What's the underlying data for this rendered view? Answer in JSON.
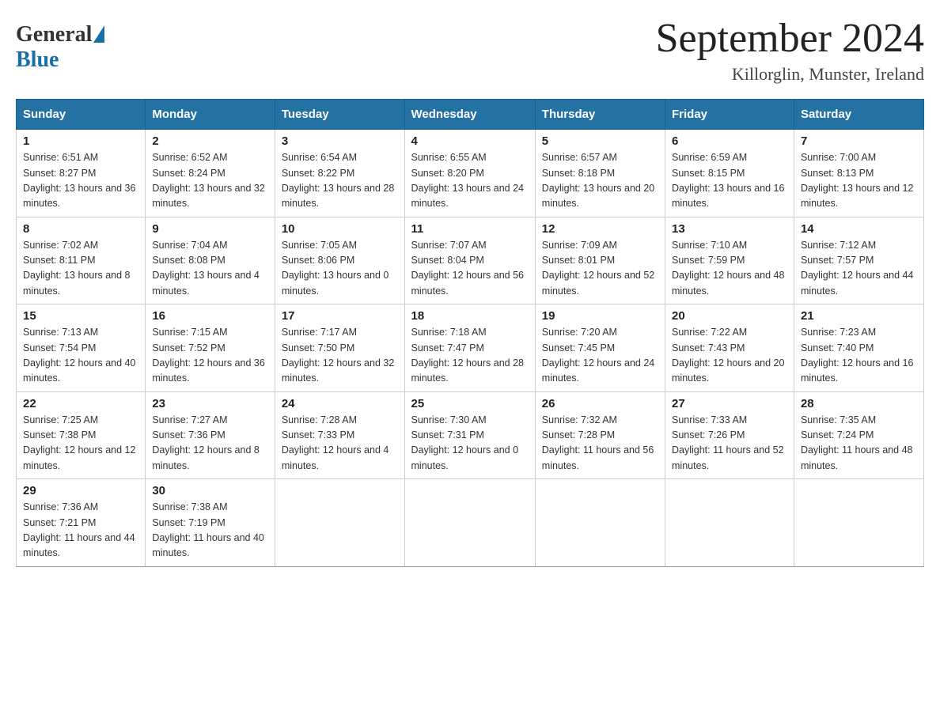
{
  "header": {
    "logo_general": "General",
    "logo_blue": "Blue",
    "month_title": "September 2024",
    "location": "Killorglin, Munster, Ireland"
  },
  "columns": [
    "Sunday",
    "Monday",
    "Tuesday",
    "Wednesday",
    "Thursday",
    "Friday",
    "Saturday"
  ],
  "weeks": [
    [
      {
        "day": "1",
        "sunrise": "6:51 AM",
        "sunset": "8:27 PM",
        "daylight": "13 hours and 36 minutes."
      },
      {
        "day": "2",
        "sunrise": "6:52 AM",
        "sunset": "8:24 PM",
        "daylight": "13 hours and 32 minutes."
      },
      {
        "day": "3",
        "sunrise": "6:54 AM",
        "sunset": "8:22 PM",
        "daylight": "13 hours and 28 minutes."
      },
      {
        "day": "4",
        "sunrise": "6:55 AM",
        "sunset": "8:20 PM",
        "daylight": "13 hours and 24 minutes."
      },
      {
        "day": "5",
        "sunrise": "6:57 AM",
        "sunset": "8:18 PM",
        "daylight": "13 hours and 20 minutes."
      },
      {
        "day": "6",
        "sunrise": "6:59 AM",
        "sunset": "8:15 PM",
        "daylight": "13 hours and 16 minutes."
      },
      {
        "day": "7",
        "sunrise": "7:00 AM",
        "sunset": "8:13 PM",
        "daylight": "13 hours and 12 minutes."
      }
    ],
    [
      {
        "day": "8",
        "sunrise": "7:02 AM",
        "sunset": "8:11 PM",
        "daylight": "13 hours and 8 minutes."
      },
      {
        "day": "9",
        "sunrise": "7:04 AM",
        "sunset": "8:08 PM",
        "daylight": "13 hours and 4 minutes."
      },
      {
        "day": "10",
        "sunrise": "7:05 AM",
        "sunset": "8:06 PM",
        "daylight": "13 hours and 0 minutes."
      },
      {
        "day": "11",
        "sunrise": "7:07 AM",
        "sunset": "8:04 PM",
        "daylight": "12 hours and 56 minutes."
      },
      {
        "day": "12",
        "sunrise": "7:09 AM",
        "sunset": "8:01 PM",
        "daylight": "12 hours and 52 minutes."
      },
      {
        "day": "13",
        "sunrise": "7:10 AM",
        "sunset": "7:59 PM",
        "daylight": "12 hours and 48 minutes."
      },
      {
        "day": "14",
        "sunrise": "7:12 AM",
        "sunset": "7:57 PM",
        "daylight": "12 hours and 44 minutes."
      }
    ],
    [
      {
        "day": "15",
        "sunrise": "7:13 AM",
        "sunset": "7:54 PM",
        "daylight": "12 hours and 40 minutes."
      },
      {
        "day": "16",
        "sunrise": "7:15 AM",
        "sunset": "7:52 PM",
        "daylight": "12 hours and 36 minutes."
      },
      {
        "day": "17",
        "sunrise": "7:17 AM",
        "sunset": "7:50 PM",
        "daylight": "12 hours and 32 minutes."
      },
      {
        "day": "18",
        "sunrise": "7:18 AM",
        "sunset": "7:47 PM",
        "daylight": "12 hours and 28 minutes."
      },
      {
        "day": "19",
        "sunrise": "7:20 AM",
        "sunset": "7:45 PM",
        "daylight": "12 hours and 24 minutes."
      },
      {
        "day": "20",
        "sunrise": "7:22 AM",
        "sunset": "7:43 PM",
        "daylight": "12 hours and 20 minutes."
      },
      {
        "day": "21",
        "sunrise": "7:23 AM",
        "sunset": "7:40 PM",
        "daylight": "12 hours and 16 minutes."
      }
    ],
    [
      {
        "day": "22",
        "sunrise": "7:25 AM",
        "sunset": "7:38 PM",
        "daylight": "12 hours and 12 minutes."
      },
      {
        "day": "23",
        "sunrise": "7:27 AM",
        "sunset": "7:36 PM",
        "daylight": "12 hours and 8 minutes."
      },
      {
        "day": "24",
        "sunrise": "7:28 AM",
        "sunset": "7:33 PM",
        "daylight": "12 hours and 4 minutes."
      },
      {
        "day": "25",
        "sunrise": "7:30 AM",
        "sunset": "7:31 PM",
        "daylight": "12 hours and 0 minutes."
      },
      {
        "day": "26",
        "sunrise": "7:32 AM",
        "sunset": "7:28 PM",
        "daylight": "11 hours and 56 minutes."
      },
      {
        "day": "27",
        "sunrise": "7:33 AM",
        "sunset": "7:26 PM",
        "daylight": "11 hours and 52 minutes."
      },
      {
        "day": "28",
        "sunrise": "7:35 AM",
        "sunset": "7:24 PM",
        "daylight": "11 hours and 48 minutes."
      }
    ],
    [
      {
        "day": "29",
        "sunrise": "7:36 AM",
        "sunset": "7:21 PM",
        "daylight": "11 hours and 44 minutes."
      },
      {
        "day": "30",
        "sunrise": "7:38 AM",
        "sunset": "7:19 PM",
        "daylight": "11 hours and 40 minutes."
      },
      null,
      null,
      null,
      null,
      null
    ]
  ]
}
